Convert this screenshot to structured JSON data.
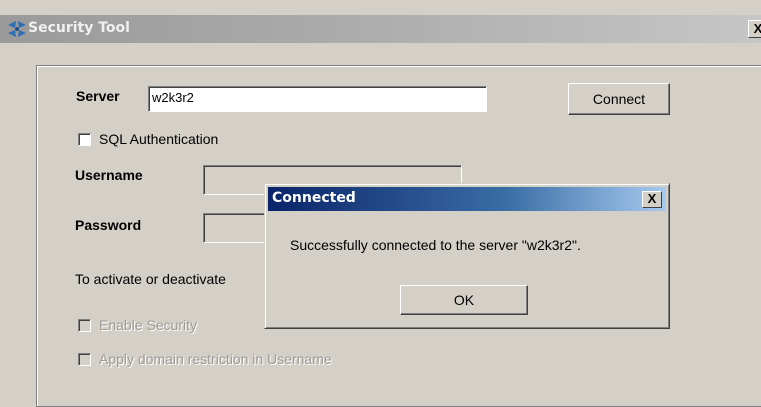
{
  "window": {
    "title": "Security Tool",
    "close_label": "X"
  },
  "form": {
    "server_label": "Server",
    "server_value": "w2k3r2",
    "connect_label": "Connect",
    "sql_auth_label": "SQL Authentication",
    "username_label": "Username",
    "username_value": "",
    "password_label": "Password",
    "password_value": "",
    "activate_text": "To activate or deactivate",
    "enable_security_label": "Enable Security",
    "domain_restriction_label": "Apply domain restriction in Username"
  },
  "dialog": {
    "title": "Connected",
    "close_label": "X",
    "message": "Successfully connected to the server \"w2k3r2\".",
    "ok_label": "OK"
  },
  "icons": {
    "app": "security-app-icon",
    "window_close": "close-icon",
    "dialog_close": "close-icon"
  }
}
